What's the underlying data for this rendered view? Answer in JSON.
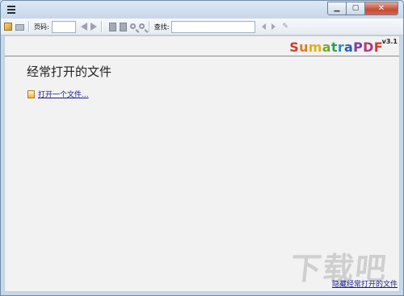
{
  "window": {
    "buttons": {
      "minimize": "▁",
      "maximize": "▢",
      "close": "✕"
    }
  },
  "toolbar": {
    "icons": [
      "open-icon",
      "print-icon",
      "prev-page-icon",
      "next-page-icon",
      "fit-page-icon",
      "fit-width-icon",
      "zoom-out-icon",
      "zoom-in-icon",
      "find-prev-icon",
      "find-next-icon",
      "match-case-icon"
    ],
    "page_label": "页码:",
    "page_value": "",
    "find_label": "查找:",
    "find_value": ""
  },
  "logo": {
    "text_letters": [
      {
        "ch": "S",
        "color": "#d13b2f"
      },
      {
        "ch": "u",
        "color": "#e57a20"
      },
      {
        "ch": "m",
        "color": "#e0b11d"
      },
      {
        "ch": "a",
        "color": "#74a832"
      },
      {
        "ch": "t",
        "color": "#2c9e5b"
      },
      {
        "ch": "r",
        "color": "#2a8fbf"
      },
      {
        "ch": "a",
        "color": "#2d5fb0"
      },
      {
        "ch": "P",
        "color": "#7a3fa7"
      },
      {
        "ch": "D",
        "color": "#b03a7c"
      },
      {
        "ch": "F",
        "color": "#d13b2f"
      }
    ],
    "version": "v3.1"
  },
  "main": {
    "heading": "经常打开的文件",
    "open_link": "打开一个文件...",
    "hide_link": "隐藏经常打开的文件"
  },
  "watermark": "下载吧"
}
